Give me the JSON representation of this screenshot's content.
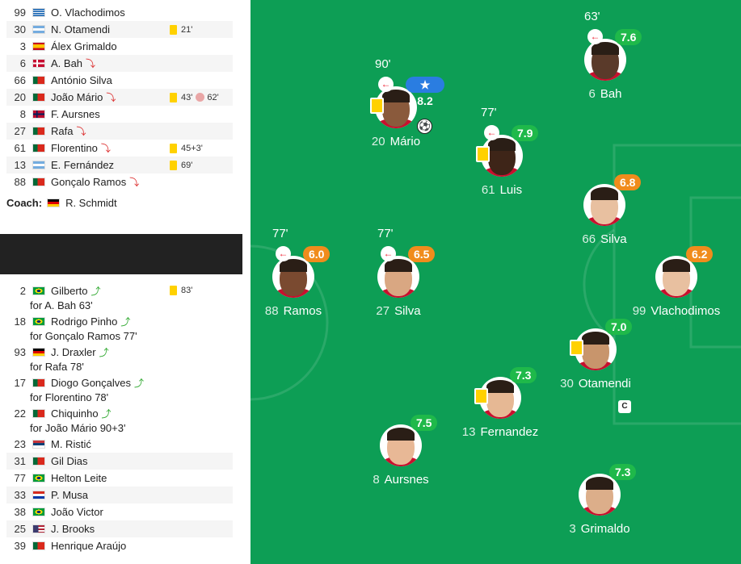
{
  "lineup": [
    {
      "num": "99",
      "flag": "gr",
      "name": "O. Vlachodimos"
    },
    {
      "num": "30",
      "flag": "ar",
      "name": "N. Otamendi",
      "card": "21'"
    },
    {
      "num": "3",
      "flag": "es",
      "name": "Álex Grimaldo"
    },
    {
      "num": "6",
      "flag": "dk",
      "name": "A. Bah",
      "sub": true
    },
    {
      "num": "66",
      "flag": "pt",
      "name": "António Silva"
    },
    {
      "num": "20",
      "flag": "pt",
      "name": "João Mário",
      "sub": true,
      "card": "43'",
      "goal": "62'"
    },
    {
      "num": "8",
      "flag": "no",
      "name": "F. Aursnes"
    },
    {
      "num": "27",
      "flag": "pt",
      "name": "Rafa",
      "sub": true
    },
    {
      "num": "61",
      "flag": "pt",
      "name": "Florentino",
      "sub": true,
      "card": "45+3'"
    },
    {
      "num": "13",
      "flag": "ar",
      "name": "E. Fernández",
      "card": "69'"
    },
    {
      "num": "88",
      "flag": "pt",
      "name": "Gonçalo Ramos",
      "sub": true
    }
  ],
  "coach": {
    "label": "Coach:",
    "flag": "de",
    "name": "R. Schmidt"
  },
  "subs_in": [
    {
      "num": "2",
      "flag": "br",
      "name": "Gilberto",
      "for": "for A. Bah 63'",
      "card": "83'"
    },
    {
      "num": "18",
      "flag": "br",
      "name": "Rodrigo Pinho",
      "for": "for Gonçalo Ramos 77'"
    },
    {
      "num": "93",
      "flag": "de",
      "name": "J. Draxler",
      "for": "for Rafa 78'"
    },
    {
      "num": "17",
      "flag": "pt",
      "name": "Diogo Gonçalves",
      "for": "for Florentino 78'"
    },
    {
      "num": "22",
      "flag": "pt",
      "name": "Chiquinho",
      "for": "for João Mário 90+3'"
    }
  ],
  "bench": [
    {
      "num": "23",
      "flag": "rs",
      "name": "M. Ristić"
    },
    {
      "num": "31",
      "flag": "pt",
      "name": "Gil Dias"
    },
    {
      "num": "77",
      "flag": "br",
      "name": "Helton Leite"
    },
    {
      "num": "33",
      "flag": "py",
      "name": "P. Musa"
    },
    {
      "num": "38",
      "flag": "br",
      "name": "João Victor"
    },
    {
      "num": "25",
      "flag": "us",
      "name": "J. Brooks"
    },
    {
      "num": "39",
      "flag": "pt",
      "name": "Henrique Araújo"
    }
  ],
  "pitch_players": [
    {
      "id": "bah",
      "num": "6",
      "name": "Bah",
      "rating": "7.6",
      "rc": "green",
      "subtime": "63'",
      "subout": true,
      "skin": "#5a3a2a"
    },
    {
      "id": "mario",
      "num": "20",
      "name": "Mário",
      "rating": "8.2",
      "rc": "blue",
      "star": true,
      "subtime": "90'",
      "subout": true,
      "ycard": true,
      "ball": true,
      "skin": "#8a5a3c"
    },
    {
      "id": "luis",
      "num": "61",
      "name": "Luis",
      "rating": "7.9",
      "rc": "green",
      "subtime": "77'",
      "subout": true,
      "ycard": true,
      "skin": "#3e2518"
    },
    {
      "id": "silva66",
      "num": "66",
      "name": "Silva",
      "rating": "6.8",
      "rc": "orange",
      "skin": "#e8c0a0"
    },
    {
      "id": "ramos",
      "num": "88",
      "name": "Ramos",
      "rating": "6.0",
      "rc": "orange",
      "subtime": "77'",
      "subout": true,
      "skin": "#7a4a30"
    },
    {
      "id": "silva27",
      "num": "27",
      "name": "Silva",
      "rating": "6.5",
      "rc": "orange",
      "subtime": "77'",
      "subout": true,
      "skin": "#d9a782"
    },
    {
      "id": "vlach",
      "num": "99",
      "name": "Vlachodimos",
      "rating": "6.2",
      "rc": "orange",
      "skin": "#e8c0a0"
    },
    {
      "id": "otamendi",
      "num": "30",
      "name": "Otamendi",
      "rating": "7.0",
      "rc": "green",
      "ycard": true,
      "captain": "C",
      "skin": "#c8956c"
    },
    {
      "id": "fernandez",
      "num": "13",
      "name": "Fernandez",
      "rating": "7.3",
      "rc": "green",
      "ycard": true,
      "skin": "#e6b894"
    },
    {
      "id": "aursnes",
      "num": "8",
      "name": "Aursnes",
      "rating": "7.5",
      "rc": "green",
      "skin": "#e8b896"
    },
    {
      "id": "grimaldo",
      "num": "3",
      "name": "Grimaldo",
      "rating": "7.3",
      "rc": "green",
      "skin": "#dcae8a"
    }
  ],
  "colors": {
    "pitch": "#0d9e55",
    "rating_green": "#1fb94a",
    "rating_orange": "#f08c1c",
    "rating_blue": "#2a7de1",
    "yellow_card": "#ffd100"
  }
}
